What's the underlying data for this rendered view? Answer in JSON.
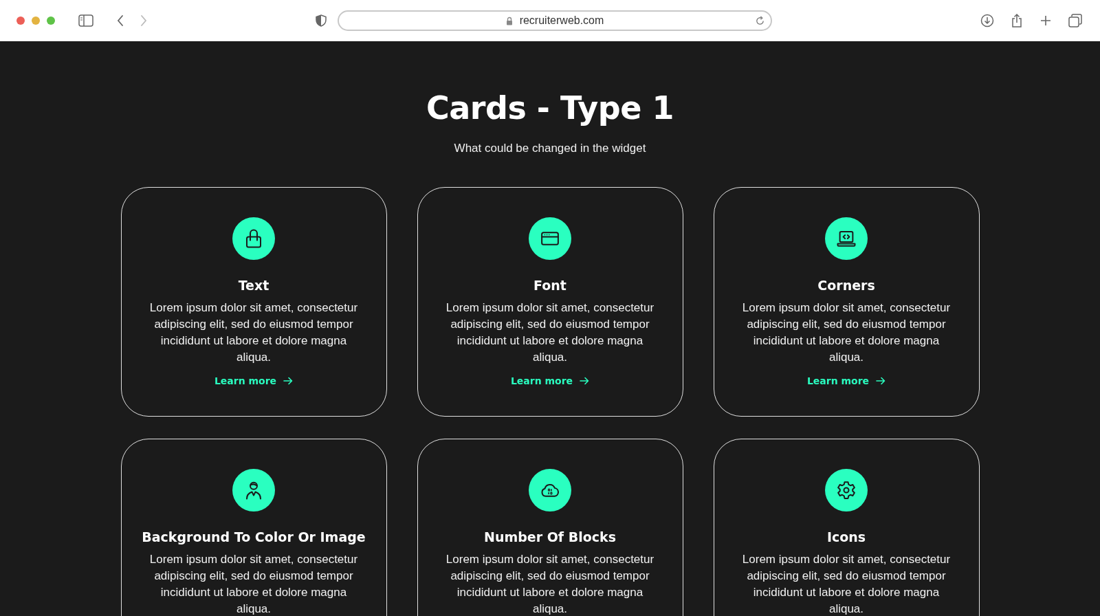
{
  "browser": {
    "url": "recruiterweb.com"
  },
  "page": {
    "title": "Cards - Type 1",
    "subtitle": "What could be changed in the widget"
  },
  "cards": [
    {
      "title": "Text",
      "body": "Lorem ipsum dolor sit amet, consectetur adipiscing elit, sed do eiusmod tempor incididunt ut labore et dolore magna aliqua.",
      "link": "Learn more"
    },
    {
      "title": "Font",
      "body": "Lorem ipsum dolor sit amet, consectetur adipiscing elit, sed do eiusmod tempor incididunt ut labore et dolore magna aliqua.",
      "link": "Learn more"
    },
    {
      "title": "Corners",
      "body": "Lorem ipsum dolor sit amet, consectetur adipiscing elit, sed do eiusmod tempor incididunt ut labore et dolore magna aliqua.",
      "link": "Learn more"
    },
    {
      "title": "Background To Color Or Image",
      "body": "Lorem ipsum dolor sit amet, consectetur adipiscing elit, sed do eiusmod tempor incididunt ut labore et dolore magna aliqua."
    },
    {
      "title": "Number Of Blocks",
      "body": "Lorem ipsum dolor sit amet, consectetur adipiscing elit, sed do eiusmod tempor incididunt ut labore et dolore magna aliqua."
    },
    {
      "title": "Icons",
      "body": "Lorem ipsum dolor sit amet, consectetur adipiscing elit, sed do eiusmod tempor incididunt ut labore et dolore magna aliqua."
    }
  ]
}
